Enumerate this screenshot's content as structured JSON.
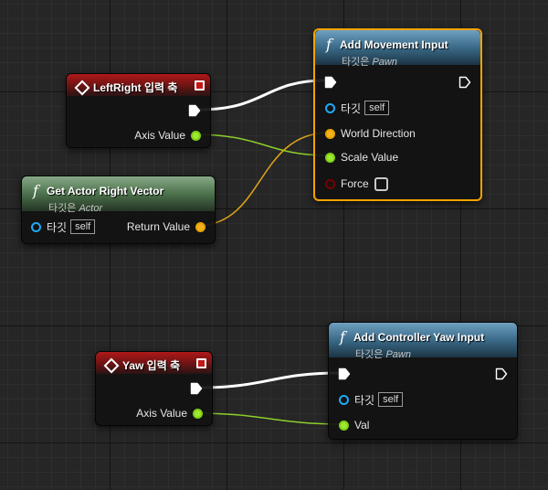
{
  "nodes": {
    "leftright_event": {
      "title": "LeftRight 입력 축",
      "output": "Axis Value"
    },
    "get_actor_right_vector": {
      "title": "Get Actor Right Vector",
      "subtitle_prefix": "타깃은",
      "subtitle_class": "Actor",
      "target_label": "타깃",
      "target_value": "self",
      "output": "Return Value"
    },
    "add_movement_input": {
      "title": "Add Movement Input",
      "subtitle_prefix": "타깃은",
      "subtitle_class": "Pawn",
      "target_label": "타깃",
      "target_value": "self",
      "inputs": [
        "World Direction",
        "Scale Value",
        "Force"
      ]
    },
    "yaw_event": {
      "title": "Yaw 입력 축",
      "output": "Axis Value"
    },
    "add_controller_yaw_input": {
      "title": "Add Controller Yaw Input",
      "subtitle_prefix": "타깃은",
      "subtitle_class": "Pawn",
      "target_label": "타깃",
      "target_value": "self",
      "inputs": [
        "Val"
      ]
    }
  },
  "colors": {
    "exec_wire": "#ffffff",
    "float_wire": "#9fe82e",
    "vector_wire": "#f2b21e",
    "selection": "#f5a300"
  }
}
